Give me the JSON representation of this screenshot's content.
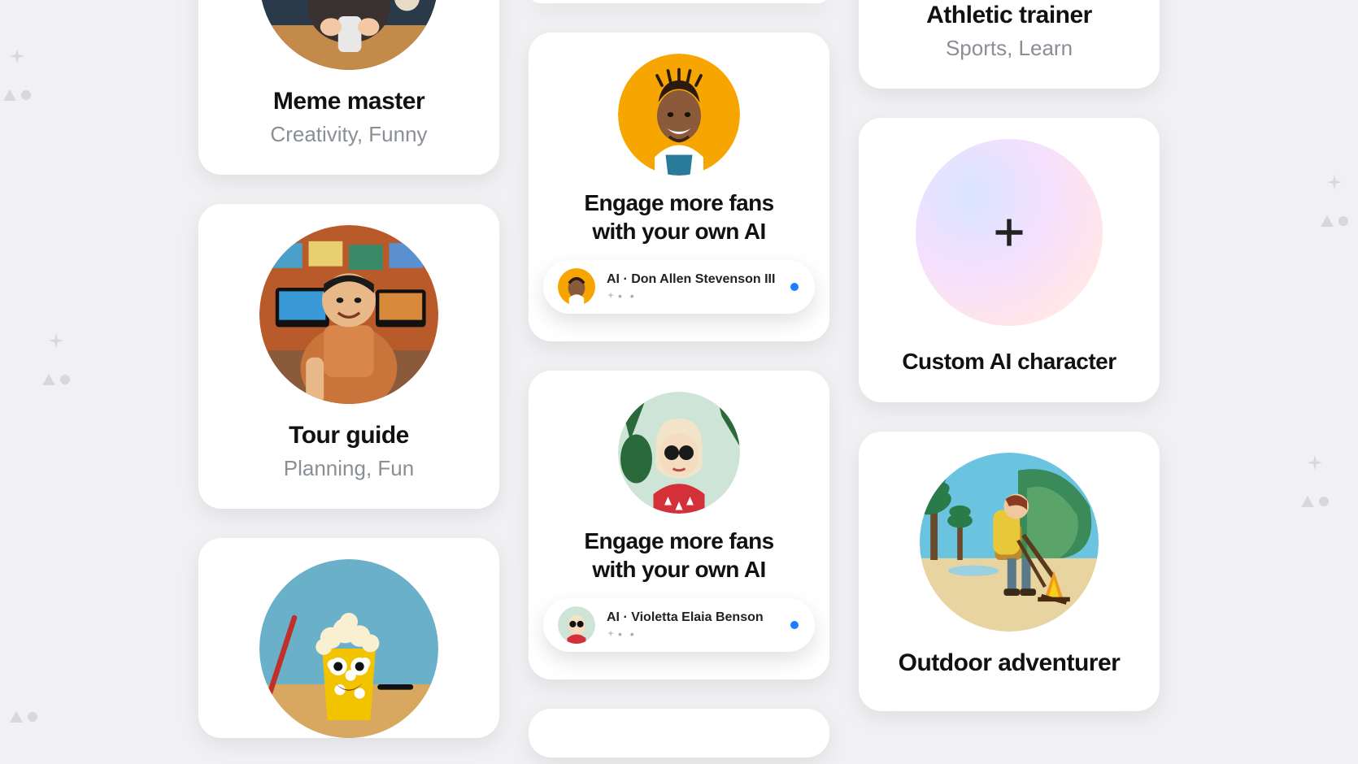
{
  "left": {
    "meme": {
      "title": "Meme master",
      "tags": "Creativity, Funny"
    },
    "tour": {
      "title": "Tour guide",
      "tags": "Planning, Fun"
    }
  },
  "mid": {
    "engage1": {
      "headline_l1": "Engage more fans",
      "headline_l2": "with your own AI",
      "pill_name": "AI · Don Allen Stevenson III"
    },
    "engage2": {
      "headline_l1": "Engage more fans",
      "headline_l2": "with your own AI",
      "pill_name": "AI · Violetta Elaia Benson"
    }
  },
  "right": {
    "athletic": {
      "title": "Athletic trainer",
      "tags": "Sports, Learn"
    },
    "custom": {
      "title": "Custom AI character"
    },
    "outdoor": {
      "title": "Outdoor adventurer"
    }
  }
}
